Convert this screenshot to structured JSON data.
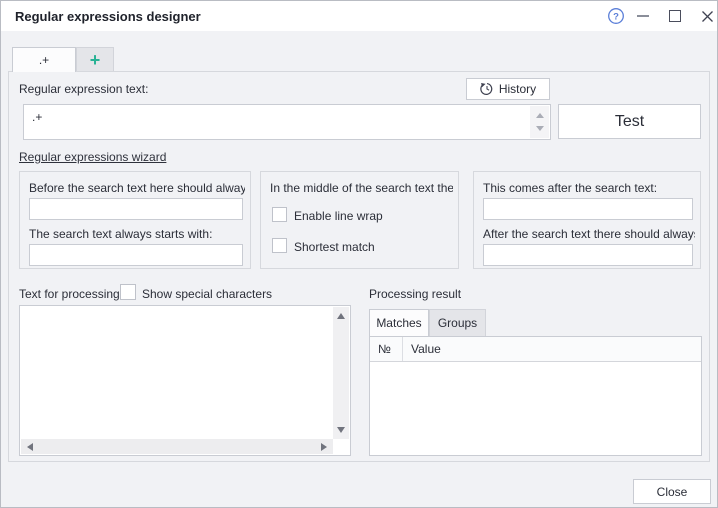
{
  "window": {
    "title": "Regular expressions designer"
  },
  "tabs": {
    "active_label": ".+",
    "add_label": "+"
  },
  "regex": {
    "label": "Regular expression text:",
    "history_button_label": "History",
    "value": ".+",
    "test_button_label": "Test",
    "wizard_link_label": "Regular expressions wizard"
  },
  "wizard_groups": {
    "before": {
      "prefix_label": "Before the search text here should always b",
      "prefix_value": "",
      "starts_with_label": "The search text always starts with:",
      "starts_with_value": ""
    },
    "middle": {
      "title": "In the middle of the search text there",
      "enable_line_wrap_label": "Enable line wrap",
      "enable_line_wrap_checked": false,
      "shortest_match_label": "Shortest match",
      "shortest_match_checked": false
    },
    "after": {
      "suffix_label": "This comes after the search text:",
      "suffix_value": "",
      "always_after_label": "After the search text there should always be",
      "always_after_value": ""
    }
  },
  "processing": {
    "text_label": "Text for processing",
    "show_special_characters_label": "Show special characters",
    "show_special_characters_checked": false,
    "text_value": "",
    "result_label": "Processing result",
    "result_tabs": [
      "Matches",
      "Groups"
    ],
    "active_result_tab": "Matches",
    "table": {
      "headers": [
        "№",
        "Value"
      ],
      "rows": []
    }
  },
  "footer": {
    "close_button_label": "Close"
  },
  "colors": {
    "accent_teal": "#28b295",
    "help_blue": "#5b7fd8",
    "background": "#f1f2f5",
    "border": "#c9ccd3",
    "text": "#2b2e38"
  }
}
